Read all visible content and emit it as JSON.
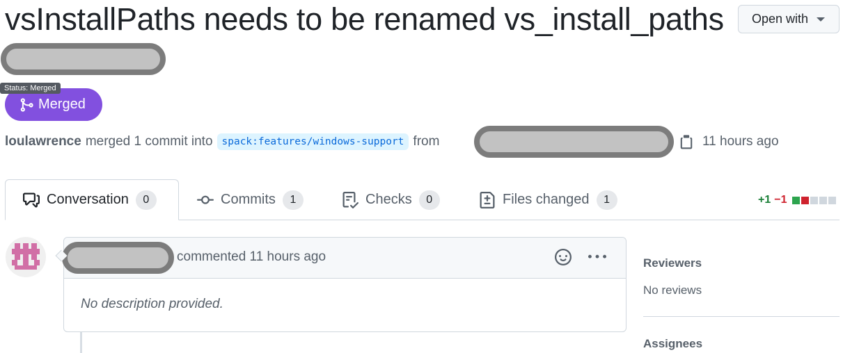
{
  "pr": {
    "title": "vsInstallPaths needs to be renamed vs_install_paths",
    "open_with_label": "Open with",
    "status_tooltip": "Status: Merged",
    "status_label": "Merged",
    "merge_author": "loulawrence",
    "merge_text": "merged 1 commit into",
    "base_branch": "spack:features/windows-support",
    "from_text": "from",
    "merged_time": "11 hours ago"
  },
  "tabs": [
    {
      "label": "Conversation",
      "count": "0",
      "icon": "comment-discussion-icon"
    },
    {
      "label": "Commits",
      "count": "1",
      "icon": "git-commit-icon"
    },
    {
      "label": "Checks",
      "count": "0",
      "icon": "checklist-icon"
    },
    {
      "label": "Files changed",
      "count": "1",
      "icon": "file-diff-icon"
    }
  ],
  "diffstat": {
    "additions": "+1",
    "deletions": "−1",
    "boxes": [
      "#2da44e",
      "#cf222e",
      "#d0d7de",
      "#d0d7de",
      "#d0d7de"
    ]
  },
  "comment": {
    "action": "commented 11 hours ago",
    "body": "No description provided."
  },
  "sidebar": {
    "reviewers_heading": "Reviewers",
    "reviewers_value": "No reviews",
    "assignees_heading": "Assignees"
  },
  "colors": {
    "merged_purple": "#8250df",
    "link_blue": "#0969da",
    "avatar_pink": "#d16fa6"
  }
}
